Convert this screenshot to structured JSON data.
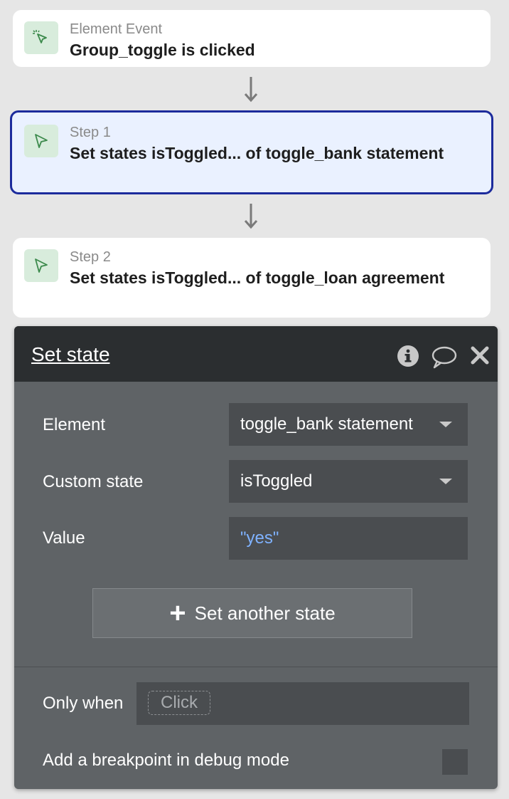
{
  "workflow": {
    "event": {
      "subtitle": "Element Event",
      "title": "Group_toggle is clicked",
      "icon": "cursor-click-icon"
    },
    "steps": [
      {
        "subtitle": "Step 1",
        "title": "Set states isToggled... of toggle_bank statement",
        "icon": "cursor-icon",
        "selected": true
      },
      {
        "subtitle": "Step 2",
        "title": "Set states isToggled... of toggle_loan agreement",
        "icon": "cursor-icon",
        "selected": false
      }
    ]
  },
  "panel": {
    "title": "Set state",
    "header_icons": [
      "info-icon",
      "comment-icon",
      "close-icon"
    ],
    "fields": {
      "element": {
        "label": "Element",
        "value": "toggle_bank statement"
      },
      "custom_state": {
        "label": "Custom state",
        "value": "isToggled"
      },
      "value": {
        "label": "Value",
        "value": "\"yes\""
      }
    },
    "add_button_label": "Set another state",
    "only_when": {
      "label": "Only when",
      "placeholder": "Click"
    },
    "breakpoint_label": "Add a breakpoint in debug mode"
  },
  "colors": {
    "accent_border": "#1c2b9c",
    "value_text": "#7fb2ff",
    "panel_header": "#2b2e30",
    "panel_body": "#5f6366"
  }
}
